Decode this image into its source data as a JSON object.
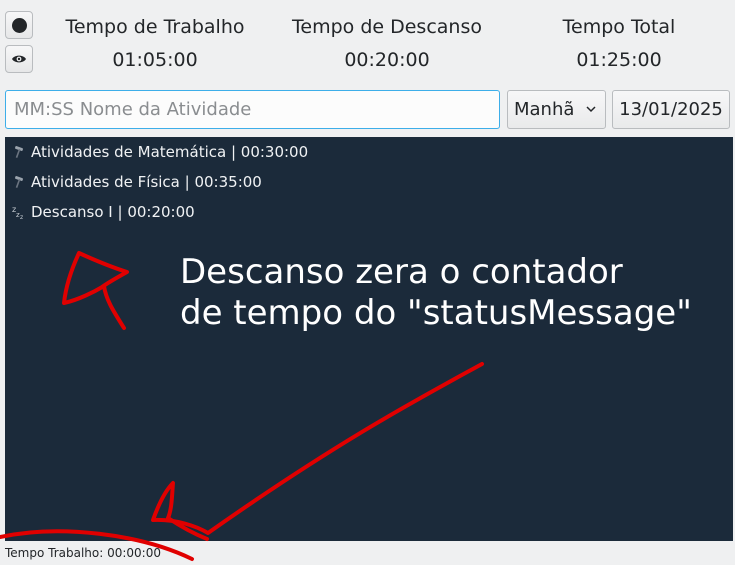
{
  "header": {
    "buttons": [
      {
        "icon": "record-dot-icon"
      },
      {
        "icon": "eye-icon"
      }
    ],
    "stats": {
      "work": {
        "label": "Tempo de Trabalho",
        "value": "01:05:00"
      },
      "rest": {
        "label": "Tempo de Descanso",
        "value": "00:20:00"
      },
      "total": {
        "label": "Tempo Total",
        "value": "01:25:00"
      }
    }
  },
  "input_row": {
    "activity_placeholder": "MM:SS Nome da Atividade",
    "activity_value": "",
    "period_selected": "Manhã",
    "date": "13/01/2025"
  },
  "activities": [
    {
      "icon": "hammer-icon",
      "text": "Atividades de Matemática | 00:30:00"
    },
    {
      "icon": "hammer-icon",
      "text": "Atividades de Física | 00:35:00"
    },
    {
      "icon": "sleep-icon",
      "text": "Descanso I | 00:20:00"
    }
  ],
  "annotation": {
    "line1": "Descanso zera o contador",
    "line2": "de tempo do \"statusMessage\"",
    "color": "#e00000"
  },
  "status_bar": {
    "text": "Tempo Trabalho: 00:00:00"
  },
  "colors": {
    "window_bg": "#eff0f1",
    "list_bg": "#1b2a3a",
    "focus_accent": "#3daee9"
  }
}
